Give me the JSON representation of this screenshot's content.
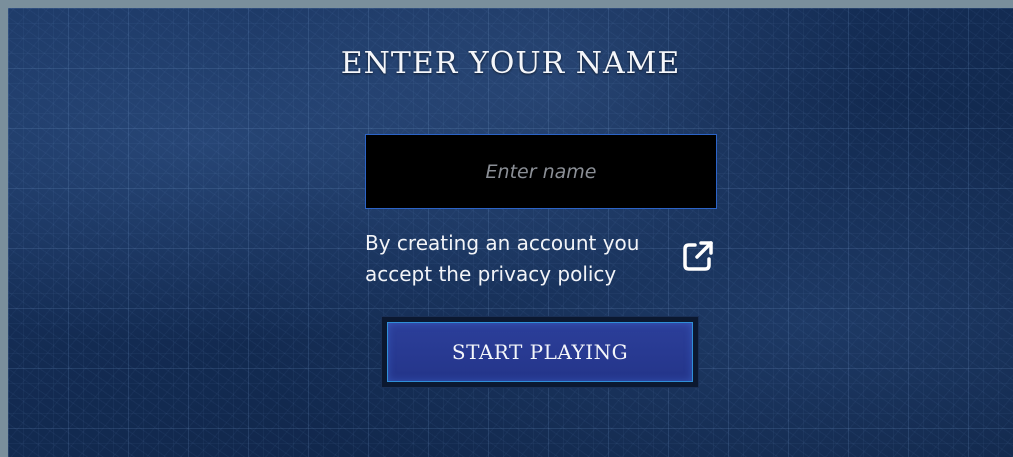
{
  "heading": "ENTER YOUR NAME",
  "name_input": {
    "value": "",
    "placeholder": "Enter name"
  },
  "privacy": {
    "line1": "By creating an account you",
    "line2": "accept the privacy policy",
    "link_icon": "external-link-icon"
  },
  "start_button_label": "START PLAYING",
  "colors": {
    "background": "#132b52",
    "input_background": "#000000",
    "input_border": "#2c64c8",
    "button_fill": "#2a3c96",
    "button_border": "#2f8fd8",
    "text": "#f4f6fa"
  }
}
